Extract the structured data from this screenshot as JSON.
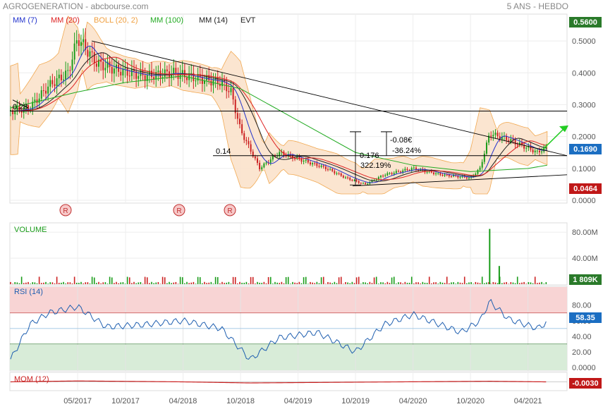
{
  "header": {
    "title": "AGROGENERATION - abcbourse.com",
    "period": "5 ANS - HEBDO",
    "legend": [
      {
        "label": "MM (7)",
        "color": "#2233cc"
      },
      {
        "label": "MM (20)",
        "color": "#dd2222"
      },
      {
        "label": "BOLL (20, 2)",
        "color": "#f0a040"
      },
      {
        "label": "MM (100)",
        "color": "#22aa22"
      },
      {
        "label": "MM (14)",
        "color": "#222222"
      },
      {
        "label": "EVT",
        "color": "#222222"
      }
    ]
  },
  "colors": {
    "up": "#1a9c1a",
    "down": "#cc2222",
    "boll_fill": "#fbe3cc",
    "boll_line": "#f0a040",
    "ma7": "#2233cc",
    "ma20": "#dd2222",
    "ma100": "#22aa22",
    "ma14": "#222222",
    "rsi_line": "#1f5fb0",
    "mom_line": "#cc2222",
    "price_badge": "#1b6ec2",
    "high_badge": "#2a7a2a",
    "low_badge": "#c01818"
  },
  "chart_data": [
    {
      "type": "line",
      "panel": "price",
      "x_ticks": [
        "05/2017",
        "10/2017",
        "04/2018",
        "10/2018",
        "04/2019",
        "10/2019",
        "04/2020",
        "10/2020",
        "04/2021"
      ],
      "y_ticks": [
        "0.5000",
        "0.4000",
        "0.3000",
        "0.2000",
        "0.1000",
        "0.0000"
      ],
      "ylim": [
        0,
        0.56
      ],
      "price_badge": "0.1690",
      "high_badge": "0.5600",
      "low_badge": "0.0464",
      "events": [
        "R",
        "R",
        "R"
      ],
      "horizontal_levels": [
        {
          "label": "0.28",
          "value": 0.28
        },
        {
          "label": "0.14",
          "value": 0.14
        }
      ],
      "annotations": [
        "0.176",
        "322.19%",
        "-0.08€",
        "-36.24%"
      ],
      "close_series": [
        {
          "date": "2016-10",
          "value": 0.28
        },
        {
          "date": "2016-12",
          "value": 0.29
        },
        {
          "date": "2017-02",
          "value": 0.36
        },
        {
          "date": "2017-04",
          "value": 0.4
        },
        {
          "date": "2017-05",
          "value": 0.51
        },
        {
          "date": "2017-07",
          "value": 0.43
        },
        {
          "date": "2017-09",
          "value": 0.41
        },
        {
          "date": "2017-12",
          "value": 0.39
        },
        {
          "date": "2018-03",
          "value": 0.4
        },
        {
          "date": "2018-06",
          "value": 0.38
        },
        {
          "date": "2018-08",
          "value": 0.37
        },
        {
          "date": "2018-09",
          "value": 0.34
        },
        {
          "date": "2018-10",
          "value": 0.22
        },
        {
          "date": "2018-12",
          "value": 0.1
        },
        {
          "date": "2019-02",
          "value": 0.15
        },
        {
          "date": "2019-04",
          "value": 0.13
        },
        {
          "date": "2019-07",
          "value": 0.1
        },
        {
          "date": "2019-09",
          "value": 0.07
        },
        {
          "date": "2019-11",
          "value": 0.05
        },
        {
          "date": "2020-01",
          "value": 0.08
        },
        {
          "date": "2020-04",
          "value": 0.1
        },
        {
          "date": "2020-07",
          "value": 0.08
        },
        {
          "date": "2020-10",
          "value": 0.07
        },
        {
          "date": "2020-11",
          "value": 0.1
        },
        {
          "date": "2020-12",
          "value": 0.21
        },
        {
          "date": "2021-02",
          "value": 0.19
        },
        {
          "date": "2021-05",
          "value": 0.15
        },
        {
          "date": "2021-06",
          "value": 0.169
        }
      ],
      "ma100_series": [
        {
          "date": "2016-10",
          "value": 0.29
        },
        {
          "date": "2017-05",
          "value": 0.34
        },
        {
          "date": "2017-10",
          "value": 0.37
        },
        {
          "date": "2018-04",
          "value": 0.39
        },
        {
          "date": "2018-10",
          "value": 0.35
        },
        {
          "date": "2019-04",
          "value": 0.25
        },
        {
          "date": "2019-10",
          "value": 0.15
        },
        {
          "date": "2020-04",
          "value": 0.11
        },
        {
          "date": "2020-10",
          "value": 0.09
        },
        {
          "date": "2021-04",
          "value": 0.1
        },
        {
          "date": "2021-06",
          "value": 0.11
        }
      ]
    },
    {
      "type": "bar",
      "panel": "volume",
      "title": "VOLUME",
      "y_ticks": [
        "80.00M",
        "40.00M"
      ],
      "ylim": [
        0,
        90
      ],
      "badge": "1 809K",
      "spikes": [
        {
          "date": "2020-12",
          "value": 85
        },
        {
          "date": "2021-01",
          "value": 28
        }
      ]
    },
    {
      "type": "line",
      "panel": "rsi",
      "title": "RSI (14)",
      "y_ticks": [
        "80.00",
        "60.00",
        "40.00",
        "20.00",
        "0.0000"
      ],
      "ylim": [
        0,
        100
      ],
      "overbought": 70,
      "oversold": 30,
      "badge": "58.35",
      "series": [
        {
          "date": "2016-10",
          "value": 10
        },
        {
          "date": "2016-12",
          "value": 55
        },
        {
          "date": "2017-02",
          "value": 70
        },
        {
          "date": "2017-05",
          "value": 78
        },
        {
          "date": "2017-08",
          "value": 52
        },
        {
          "date": "2017-12",
          "value": 55
        },
        {
          "date": "2018-04",
          "value": 60
        },
        {
          "date": "2018-08",
          "value": 50
        },
        {
          "date": "2018-11",
          "value": 10
        },
        {
          "date": "2019-02",
          "value": 38
        },
        {
          "date": "2019-06",
          "value": 45
        },
        {
          "date": "2019-10",
          "value": 20
        },
        {
          "date": "2020-01",
          "value": 55
        },
        {
          "date": "2020-04",
          "value": 68
        },
        {
          "date": "2020-09",
          "value": 45
        },
        {
          "date": "2020-11",
          "value": 60
        },
        {
          "date": "2020-12",
          "value": 85
        },
        {
          "date": "2021-02",
          "value": 62
        },
        {
          "date": "2021-05",
          "value": 50
        },
        {
          "date": "2021-06",
          "value": 58.35
        }
      ]
    },
    {
      "type": "line",
      "panel": "momentum",
      "title": "MOM (12)",
      "badge": "-0.0030",
      "ylim": [
        -0.2,
        0.2
      ],
      "series": [
        {
          "date": "2016-10",
          "value": 0.0
        },
        {
          "date": "2017-05",
          "value": 0.15
        },
        {
          "date": "2018-04",
          "value": 0.0
        },
        {
          "date": "2018-11",
          "value": -0.18
        },
        {
          "date": "2019-10",
          "value": -0.05
        },
        {
          "date": "2020-12",
          "value": 0.1
        },
        {
          "date": "2021-06",
          "value": -0.003
        }
      ]
    }
  ]
}
